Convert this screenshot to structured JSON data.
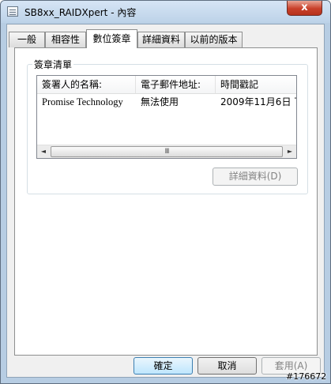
{
  "window": {
    "title": "SB8xx_RAIDXpert - 內容",
    "close_glyph": "x"
  },
  "tabs": [
    {
      "label": "一般"
    },
    {
      "label": "相容性"
    },
    {
      "label": "數位簽章"
    },
    {
      "label": "詳細資料"
    },
    {
      "label": "以前的版本"
    }
  ],
  "signature_list": {
    "group_label": "簽章清單",
    "columns": [
      "簽署人的名稱:",
      "電子郵件地址:",
      "時間戳記"
    ],
    "rows": [
      {
        "signer": "Promise Technology",
        "email": "無法使用",
        "timestamp": "2009年11月6日 下..."
      }
    ],
    "details_button": "詳細資料(D)"
  },
  "scrollbar": {
    "left_arrow": "◄",
    "right_arrow": "►",
    "grip": "III"
  },
  "footer": {
    "ok": "確定",
    "cancel": "取消",
    "apply": "套用(A)"
  },
  "watermark": "#176672"
}
